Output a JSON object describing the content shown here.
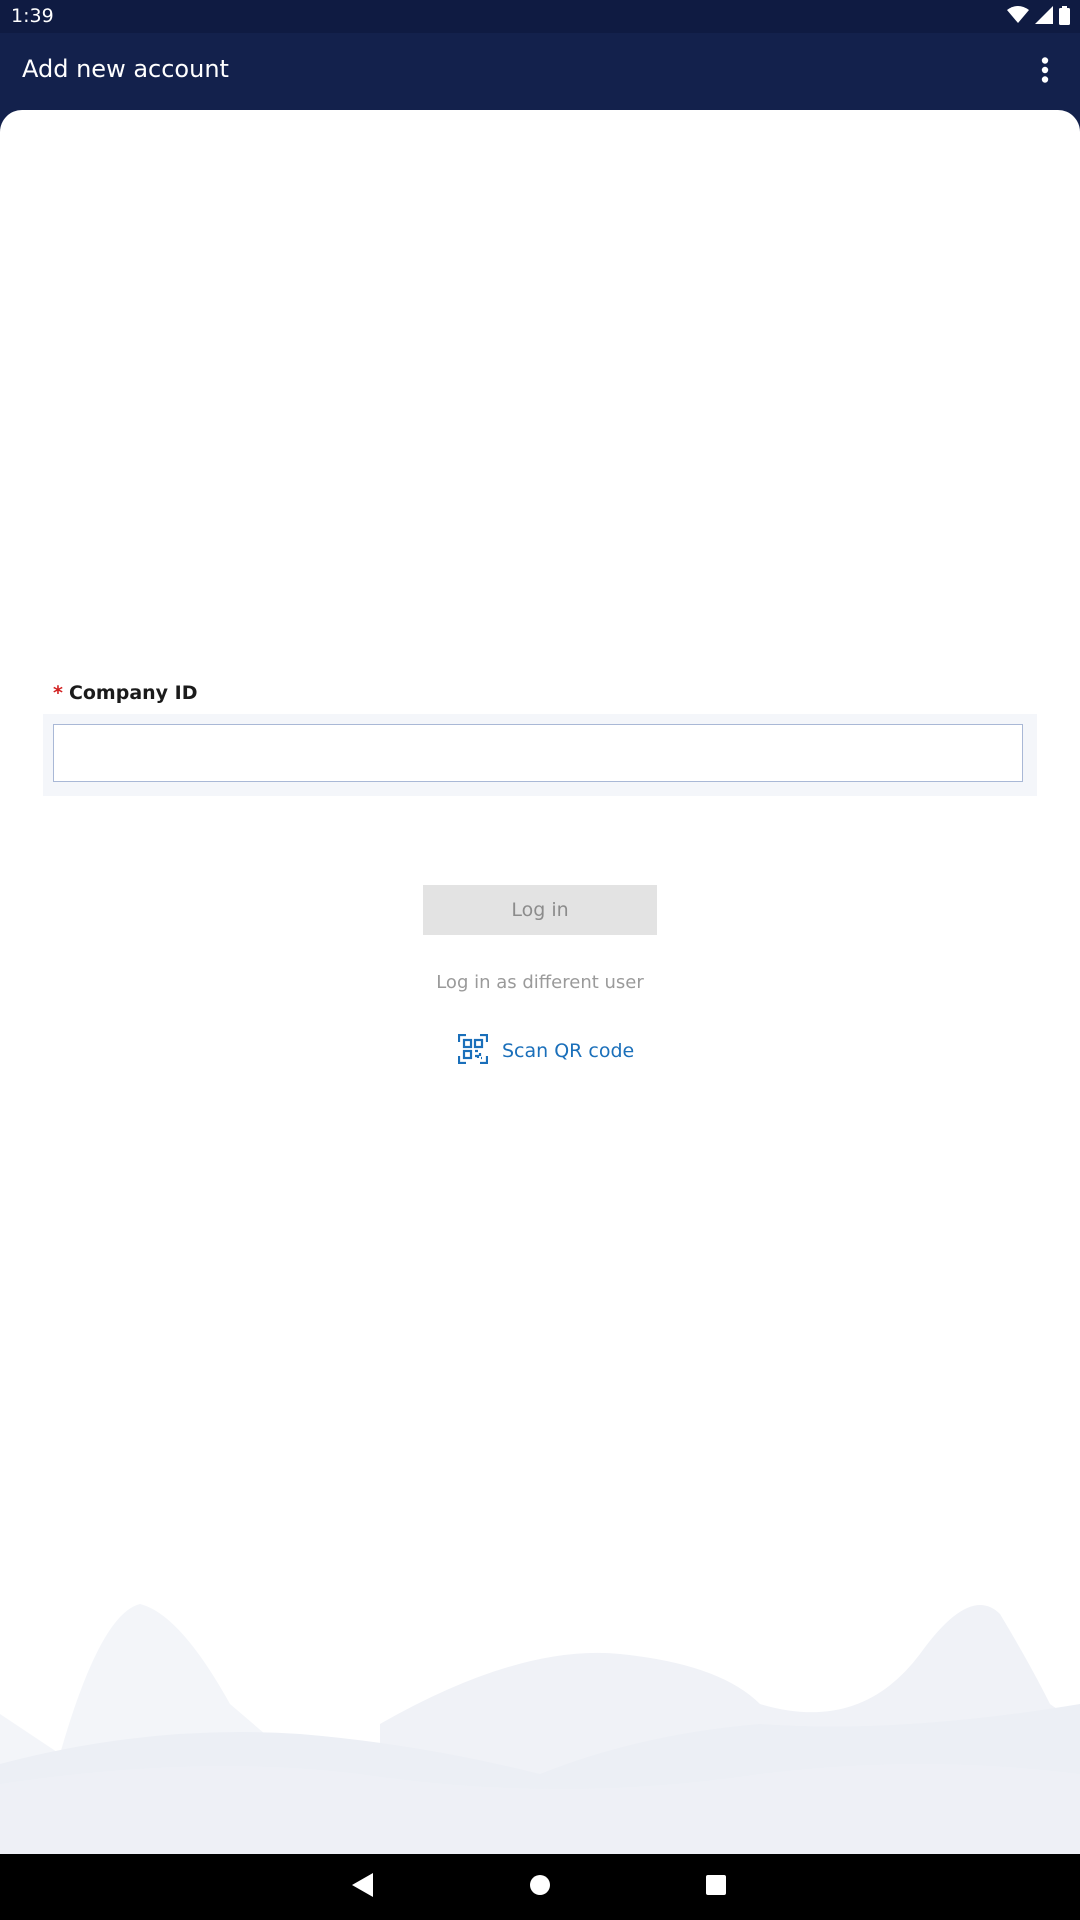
{
  "status_bar": {
    "time": "1:39",
    "icons": [
      "wifi-icon",
      "signal-icon",
      "battery-icon"
    ]
  },
  "app_bar": {
    "title": "Add new account",
    "menu_icon": "more-vert-icon"
  },
  "form": {
    "required_marker": "*",
    "company_id_label": "Company ID",
    "company_id_value": "",
    "company_id_placeholder": ""
  },
  "actions": {
    "login_label": "Log in",
    "different_user_label": "Log in as different user",
    "scan_qr_label": "Scan QR code",
    "scan_qr_icon": "qr-scan-icon"
  },
  "nav_bar": {
    "back_icon": "back-icon",
    "home_icon": "home-icon",
    "recents_icon": "recents-icon"
  },
  "colors": {
    "app_bar": "#13214c",
    "status_bar": "#0f1b42",
    "link_blue": "#1a6fba",
    "required_red": "#d22020",
    "disabled_button": "#e3e3e3"
  }
}
